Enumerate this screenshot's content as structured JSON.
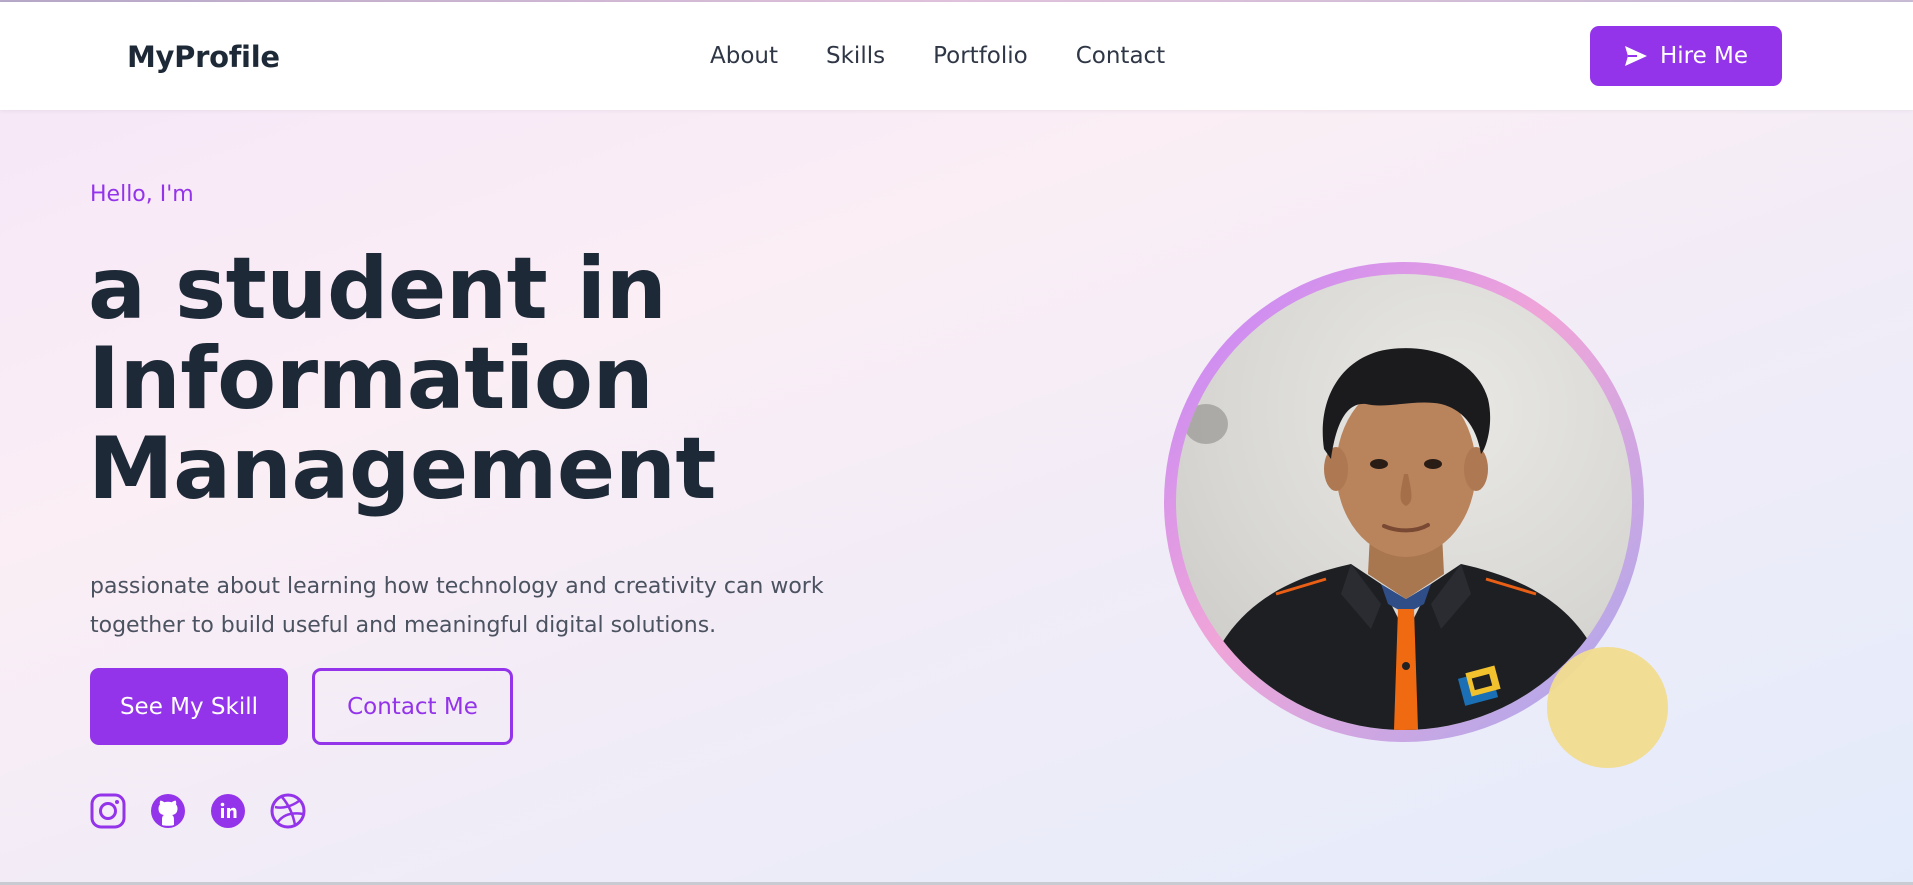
{
  "nav": {
    "brand": "MyProfile",
    "links": [
      "About",
      "Skills",
      "Portfolio",
      "Contact"
    ],
    "hire_label": "Hire Me"
  },
  "hero": {
    "greeting": "Hello, I'm",
    "headline_lines": [
      "a student in",
      "Information",
      "Management"
    ],
    "description": "passionate about learning how technology and creativity can work together to build useful and meaningful digital solutions.",
    "primary_button": "See My Skill",
    "secondary_button": "Contact Me"
  },
  "socials": {
    "icons": [
      "instagram-icon",
      "github-icon",
      "linkedin-icon",
      "dribbble-icon"
    ]
  },
  "colors": {
    "accent": "#9333ea",
    "heading": "#1e2937",
    "body_text": "#4b5260",
    "decor_dot": "#f1dc8e"
  }
}
